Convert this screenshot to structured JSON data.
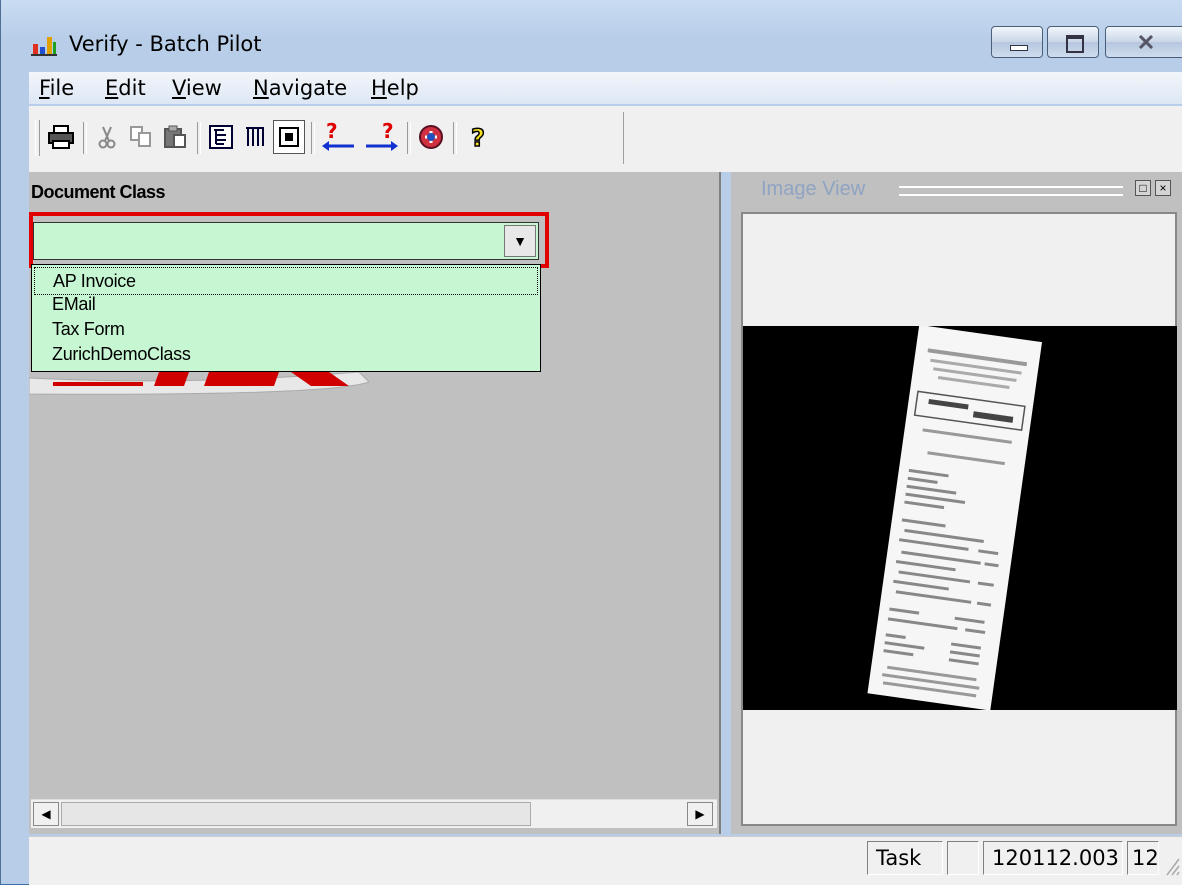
{
  "window": {
    "title": "Verify - Batch Pilot",
    "buttons": [
      "minimize",
      "maximize",
      "close"
    ]
  },
  "menu": {
    "items": [
      {
        "label": "File",
        "key": "F",
        "rest": "ile"
      },
      {
        "label": "Edit",
        "key": "E",
        "rest": "dit"
      },
      {
        "label": "View",
        "key": "V",
        "rest": "iew"
      },
      {
        "label": "Navigate",
        "key": "N",
        "rest": "avigate"
      },
      {
        "label": "Help",
        "key": "H",
        "rest": "elp"
      }
    ]
  },
  "toolbar": {
    "icons": [
      "print-icon",
      "cut-icon",
      "copy-icon",
      "paste-icon",
      "tree-view-icon",
      "grid-view-icon",
      "single-view-icon",
      "prev-question-icon",
      "next-question-icon",
      "sync-icon",
      "help-icon"
    ]
  },
  "left_panel": {
    "label": "Document Class",
    "combo_value": "",
    "options": [
      "AP Invoice",
      "EMail",
      "Tax Form",
      "ZurichDemoClass"
    ],
    "selected_index": 0
  },
  "image_view": {
    "title": "Image View"
  },
  "status": {
    "task_label": "Task",
    "empty_cell": "",
    "batch_id": "120112.003",
    "count": "12"
  },
  "colors": {
    "combo_bg": "#c6f7d2",
    "highlight_border": "#e00000",
    "panel_bg": "#c0c0c0"
  }
}
